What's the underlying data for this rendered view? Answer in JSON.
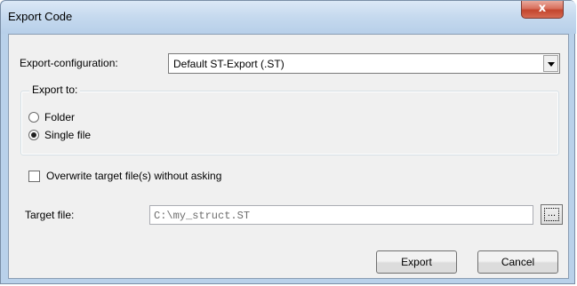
{
  "window": {
    "title": "Export Code",
    "close_label": "x"
  },
  "config": {
    "label": "Export-configuration:",
    "selected": "Default ST-Export (.ST)"
  },
  "export_to": {
    "legend": "Export to:",
    "options": [
      {
        "label": "Folder",
        "checked": false
      },
      {
        "label": "Single file",
        "checked": true
      }
    ]
  },
  "overwrite": {
    "label": "Overwrite target file(s) without asking",
    "checked": false
  },
  "target": {
    "label": "Target file:",
    "value": "C:\\my_struct.ST",
    "browse_label": "..."
  },
  "buttons": {
    "export": "Export",
    "cancel": "Cancel"
  }
}
